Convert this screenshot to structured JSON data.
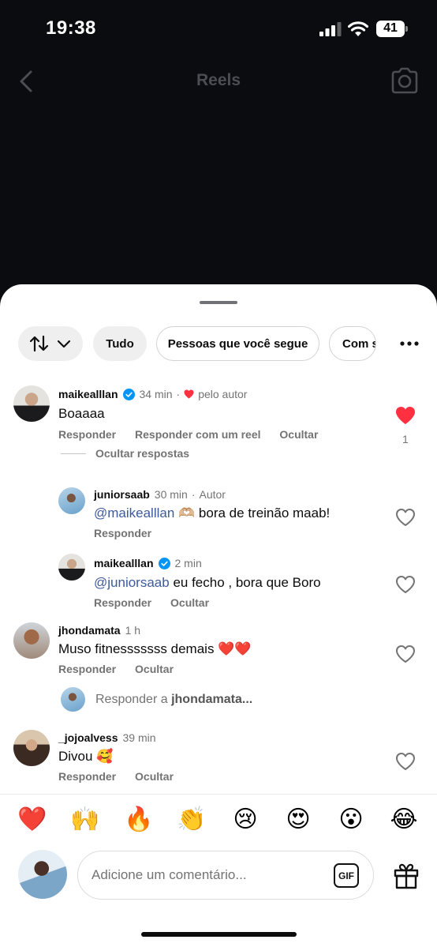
{
  "status_bar": {
    "time": "19:38",
    "battery": "41"
  },
  "header": {
    "title": "Reels"
  },
  "filters": {
    "sort_label": "",
    "chips": [
      "Tudo",
      "Pessoas que você segue",
      "Com s"
    ]
  },
  "comments": [
    {
      "username": "maikealllan",
      "verified": true,
      "time": "34 min",
      "meta_extra": "pelo autor",
      "text": "Boaaaa",
      "actions": [
        "Responder",
        "Responder com um reel",
        "Ocultar"
      ],
      "likes": "1",
      "liked": true,
      "hide_replies": "Ocultar respostas",
      "replies": [
        {
          "username": "juniorsaab",
          "time": "30 min",
          "meta_extra": "Autor",
          "mention": "@maikealllan",
          "text": "🫶🏼 bora de treinão maab!",
          "actions": [
            "Responder"
          ]
        },
        {
          "username": "maikealllan",
          "verified": true,
          "time": "2 min",
          "mention": "@juniorsaab",
          "text": "eu fecho , bora que Boro",
          "actions": [
            "Responder",
            "Ocultar"
          ]
        }
      ]
    },
    {
      "username": "jhondamata",
      "time": "1 h",
      "text": "Muso fitnesssssss demais ❤️❤️",
      "actions": [
        "Responder",
        "Ocultar"
      ],
      "reply_prompt_prefix": "Responder a",
      "reply_prompt_user": "jhondamata..."
    },
    {
      "username": "_jojoalvess",
      "time": "39 min",
      "text": "Divou 🥰",
      "actions": [
        "Responder",
        "Ocultar"
      ]
    }
  ],
  "emoji_bar": [
    "❤️",
    "🙌",
    "🔥",
    "👏",
    "😢",
    "😍",
    "😮",
    "😂"
  ],
  "composer": {
    "placeholder": "Adicione um comentário...",
    "gif_label": "GIF"
  },
  "colors": {
    "accent_like": "#ff3040",
    "mention": "#3d5a9e",
    "verified": "#0095f6"
  }
}
